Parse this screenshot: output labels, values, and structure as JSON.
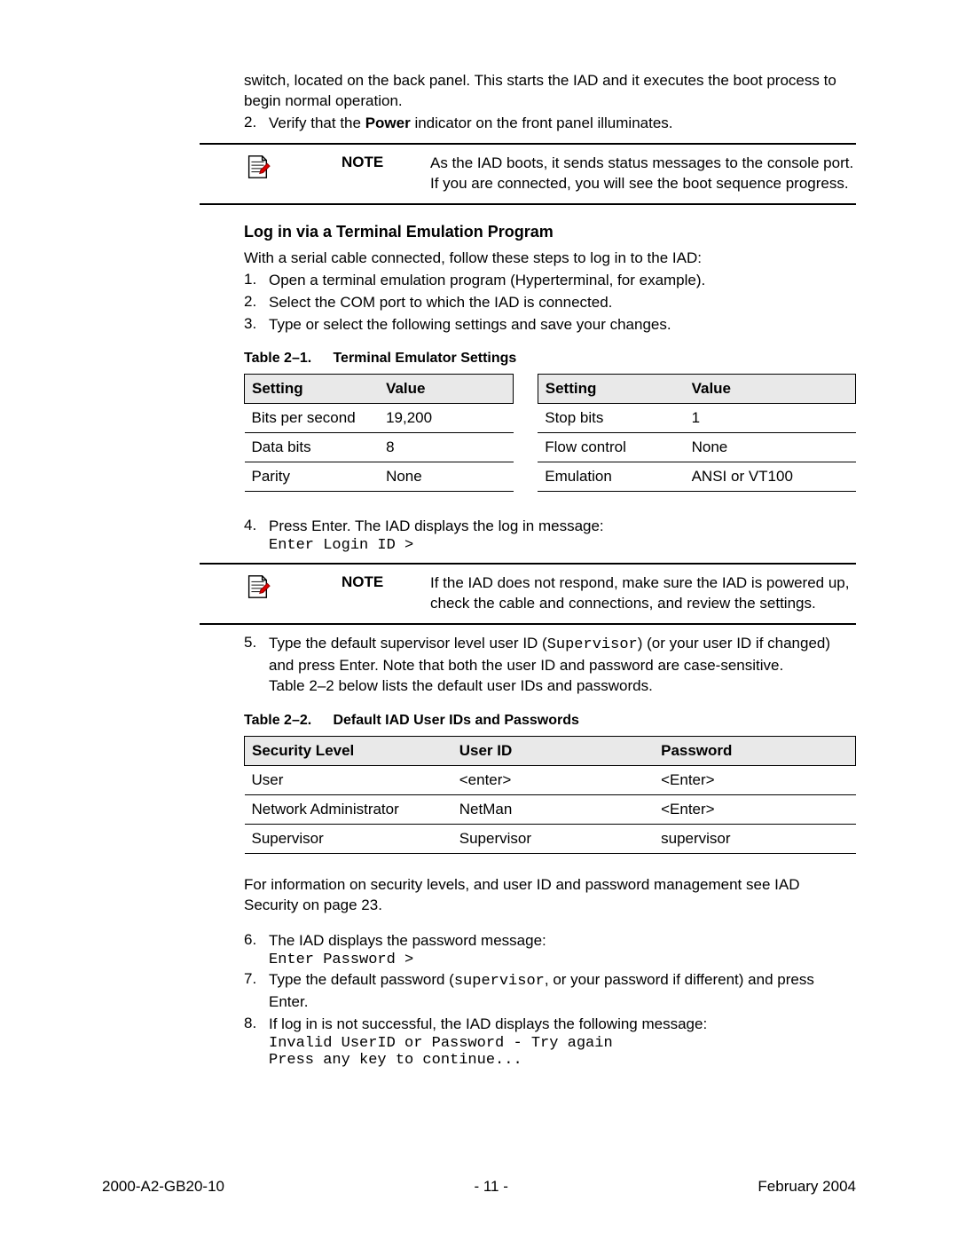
{
  "intro": {
    "switch_line": "switch, located on the back panel. This starts the IAD and it executes the boot process to begin normal operation.",
    "step2_prefix": "Verify that the ",
    "step2_bold": "Power",
    "step2_suffix": " indicator on the front panel illuminates.",
    "step2_num": "2."
  },
  "note1": {
    "label": "NOTE",
    "text": "As the IAD boots, it sends status messages to the console port. If you are connected, you will see the boot sequence progress."
  },
  "section": {
    "title": "Log in via a Terminal Emulation Program",
    "intro": "With a serial cable connected, follow these steps to log in to the IAD:",
    "step1": "Open a terminal emulation program (Hyperterminal, for example).",
    "step2": "Select the COM port to which the IAD is connected.",
    "step3": "Type or select the following settings and save your changes.",
    "n1": "1.",
    "n2": "2.",
    "n3": "3."
  },
  "table1": {
    "caption_num": "Table 2–1.",
    "caption_title": "Terminal Emulator Settings",
    "h1": "Setting",
    "h2": "Value",
    "h3": "Setting",
    "h4": "Value",
    "rows": [
      {
        "a": "Bits per second",
        "b": "19,200",
        "c": "Stop bits",
        "d": "1"
      },
      {
        "a": "Data bits",
        "b": "8",
        "c": "Flow control",
        "d": "None"
      },
      {
        "a": "Parity",
        "b": "None",
        "c": "Emulation",
        "d": "ANSI or VT100"
      }
    ]
  },
  "step4": {
    "num": "4.",
    "text": "Press Enter. The IAD displays the log in message:",
    "code": "Enter Login ID >"
  },
  "note2": {
    "label": "NOTE",
    "text": "If the IAD does not respond, make sure the IAD is powered up, check the cable and connections, and review the settings."
  },
  "step5": {
    "num": "5.",
    "part1": "Type the default supervisor level user ID (",
    "code": "Supervisor",
    "part2": ") (or your user ID if changed) and press Enter. Note that both the user ID and password are case-sensitive.",
    "part3": "Table 2–2 below lists the default user IDs and passwords."
  },
  "table2": {
    "caption_num": "Table 2–2.",
    "caption_title": "Default IAD User IDs and Passwords",
    "h1": "Security Level",
    "h2": "User ID",
    "h3": "Password",
    "rows": [
      {
        "a": "User",
        "b": "<enter>",
        "c": "<Enter>"
      },
      {
        "a": "Network Administrator",
        "b": "NetMan",
        "c": "<Enter>"
      },
      {
        "a": "Supervisor",
        "b": "Supervisor",
        "c": "supervisor"
      }
    ]
  },
  "post": {
    "para": "For information on security levels, and user ID and password management see IAD Security on page 23."
  },
  "step6": {
    "num": "6.",
    "text": "The IAD displays the password message:",
    "code": "Enter Password >"
  },
  "step7": {
    "num": "7.",
    "part1": "Type the default password (",
    "code": "supervisor",
    "part2": ", or your password if different) and press Enter."
  },
  "step8": {
    "num": "8.",
    "text": "If log in is not successful, the IAD displays the following message:",
    "code1": "Invalid UserID or Password - Try again",
    "code2": "Press any key to continue..."
  },
  "footer": {
    "left": "2000-A2-GB20-10",
    "center": "- 11 -",
    "right": "February 2004"
  }
}
